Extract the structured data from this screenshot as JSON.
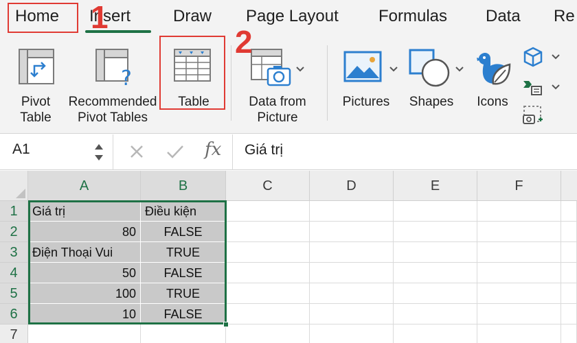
{
  "tabs": [
    {
      "label": "Home"
    },
    {
      "label": "Insert"
    },
    {
      "label": "Draw"
    },
    {
      "label": "Page Layout"
    },
    {
      "label": "Formulas"
    },
    {
      "label": "Data"
    },
    {
      "label": "Re"
    }
  ],
  "active_tab": "Insert",
  "annotations": {
    "step1": "1",
    "step2": "2",
    "color": "#e03a33"
  },
  "ribbon": {
    "pivot_table": {
      "line1": "Pivot",
      "line2": "Table",
      "icon": "pivot-table-icon"
    },
    "recommended": {
      "line1": "Recommended",
      "line2": "Pivot Tables",
      "icon": "recommended-pivot-icon"
    },
    "table": {
      "line1": "Table",
      "icon": "table-icon"
    },
    "data_from_picture": {
      "line1": "Data from",
      "line2": "Picture",
      "icon": "camera-table-icon"
    },
    "pictures": {
      "label": "Pictures",
      "icon": "picture-icon"
    },
    "shapes": {
      "label": "Shapes",
      "icon": "shapes-icon"
    },
    "icons": {
      "label": "Icons",
      "icon": "icons-icon"
    }
  },
  "formula_bar": {
    "name_box": "A1",
    "fx": "fx",
    "value": "Giá trị"
  },
  "columns": [
    "A",
    "B",
    "C",
    "D",
    "E",
    "F"
  ],
  "rows": [
    "1",
    "2",
    "3",
    "4",
    "5",
    "6",
    "7"
  ],
  "cells": [
    {
      "a": "Giá trị",
      "b": "Điều kiện"
    },
    {
      "a": "80",
      "b": "FALSE"
    },
    {
      "a": "Điện Thoại Vui",
      "b": "TRUE"
    },
    {
      "a": "50",
      "b": "FALSE"
    },
    {
      "a": "100",
      "b": "TRUE"
    },
    {
      "a": "10",
      "b": "FALSE"
    }
  ],
  "colors": {
    "accent": "#1e7145",
    "selection_fill": "#c9c9c9",
    "ribbon_bg": "#f3f3f3"
  }
}
